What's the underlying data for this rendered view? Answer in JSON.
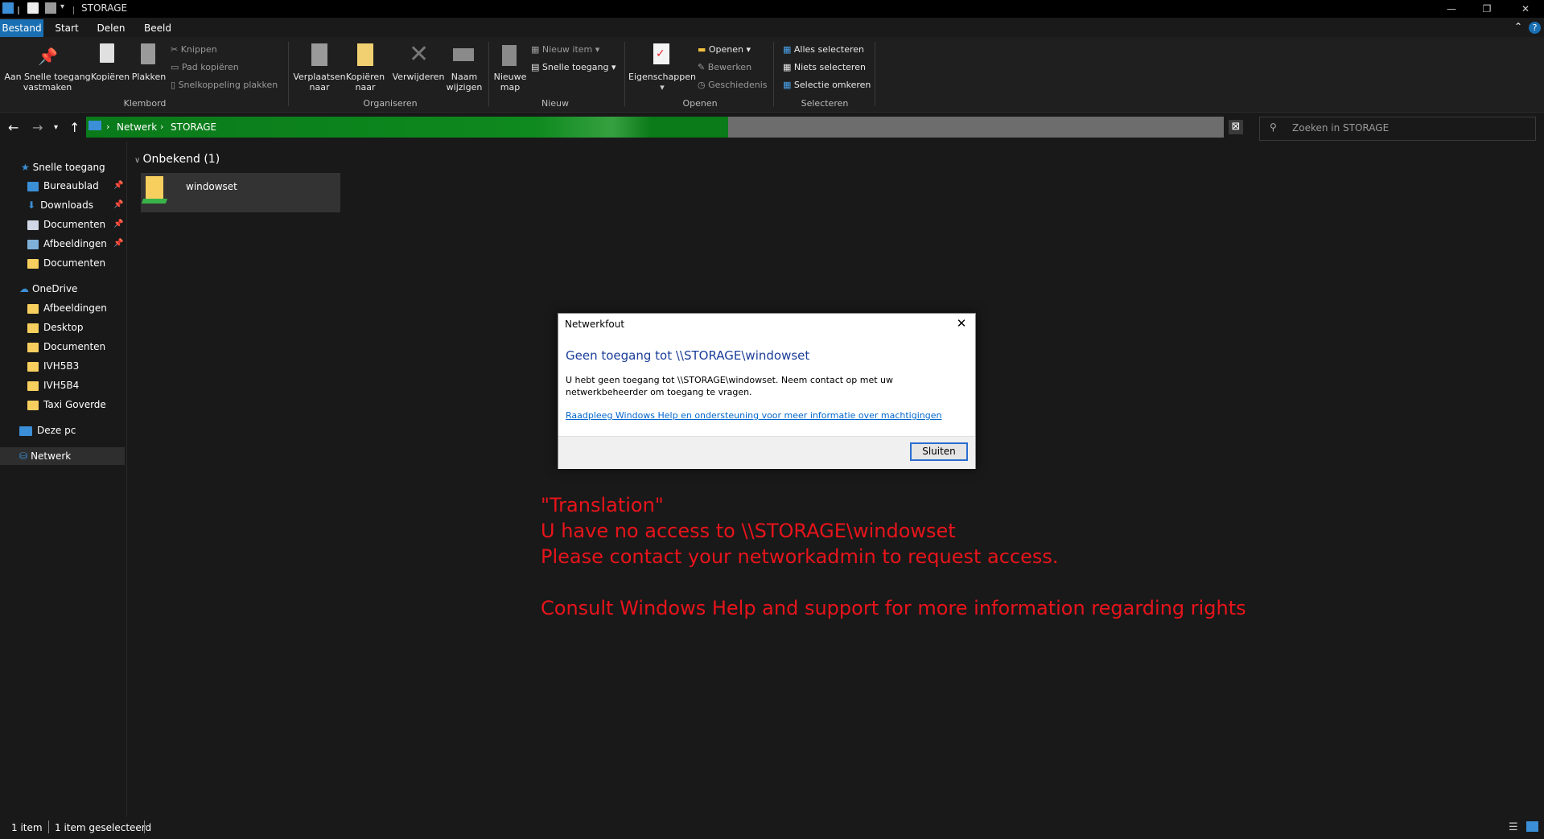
{
  "window": {
    "title": "STORAGE"
  },
  "ribbon_tabs": [
    "Bestand",
    "Start",
    "Delen",
    "Beeld"
  ],
  "ribbon": {
    "clipboard": {
      "pin_label_1": "Aan Snelle toegang",
      "pin_label_2": "vastmaken",
      "copy": "Kopiëren",
      "paste": "Plakken",
      "cut": "Knippen",
      "copy_path": "Pad kopiëren",
      "paste_shortcut": "Snelkoppeling plakken",
      "group": "Klembord"
    },
    "organize": {
      "move_1": "Verplaatsen",
      "move_2": "naar",
      "copyto_1": "Kopiëren",
      "copyto_2": "naar",
      "delete": "Verwijderen",
      "rename_1": "Naam",
      "rename_2": "wijzigen",
      "group": "Organiseren"
    },
    "new": {
      "folder_1": "Nieuwe",
      "folder_2": "map",
      "new_item": "Nieuw item",
      "easy_access": "Snelle toegang",
      "group": "Nieuw"
    },
    "open": {
      "properties": "Eigenschappen",
      "open": "Openen",
      "edit": "Bewerken",
      "history": "Geschiedenis",
      "group": "Openen"
    },
    "select": {
      "select_all": "Alles selecteren",
      "select_none": "Niets selecteren",
      "invert": "Selectie omkeren",
      "group": "Selecteren"
    }
  },
  "address": {
    "crumb1": "Netwerk",
    "crumb2": "STORAGE"
  },
  "search": {
    "placeholder": "Zoeken in STORAGE"
  },
  "sidebar": {
    "quick_access": "Snelle toegang",
    "quick_items": [
      "Bureaublad",
      "Downloads",
      "Documenten",
      "Afbeeldingen",
      "Documenten"
    ],
    "onedrive": "OneDrive",
    "onedrive_items": [
      "Afbeeldingen",
      "Desktop",
      "Documenten",
      "IVH5B3",
      "IVH5B4",
      "Taxi Goverde"
    ],
    "this_pc": "Deze pc",
    "network": "Netwerk"
  },
  "content": {
    "group_header": "Onbekend (1)",
    "file_name": "windowset"
  },
  "dialog": {
    "title": "Netwerkfout",
    "heading": "Geen toegang tot \\\\STORAGE\\windowset",
    "body": "U hebt geen toegang tot \\\\STORAGE\\windowset. Neem contact op met uw netwerkbeheerder om toegang te vragen.",
    "link": "Raadpleeg Windows Help en ondersteuning voor meer informatie over machtigingen",
    "button": "Sluiten"
  },
  "translation": {
    "line1": "\"Translation\"",
    "line2": "U have no access to \\\\STORAGE\\windowset",
    "line3": "Please contact your networkadmin to request access.",
    "line4": "Consult Windows Help and support for more information regarding rights"
  },
  "status": {
    "count": "1 item",
    "selected": "1 item geselecteerd"
  },
  "colors": {
    "accent": "#1a6fb3",
    "progress": "#0e8a1e",
    "dialog_heading": "#1a3d99",
    "overlay_text": "#e8141b"
  }
}
